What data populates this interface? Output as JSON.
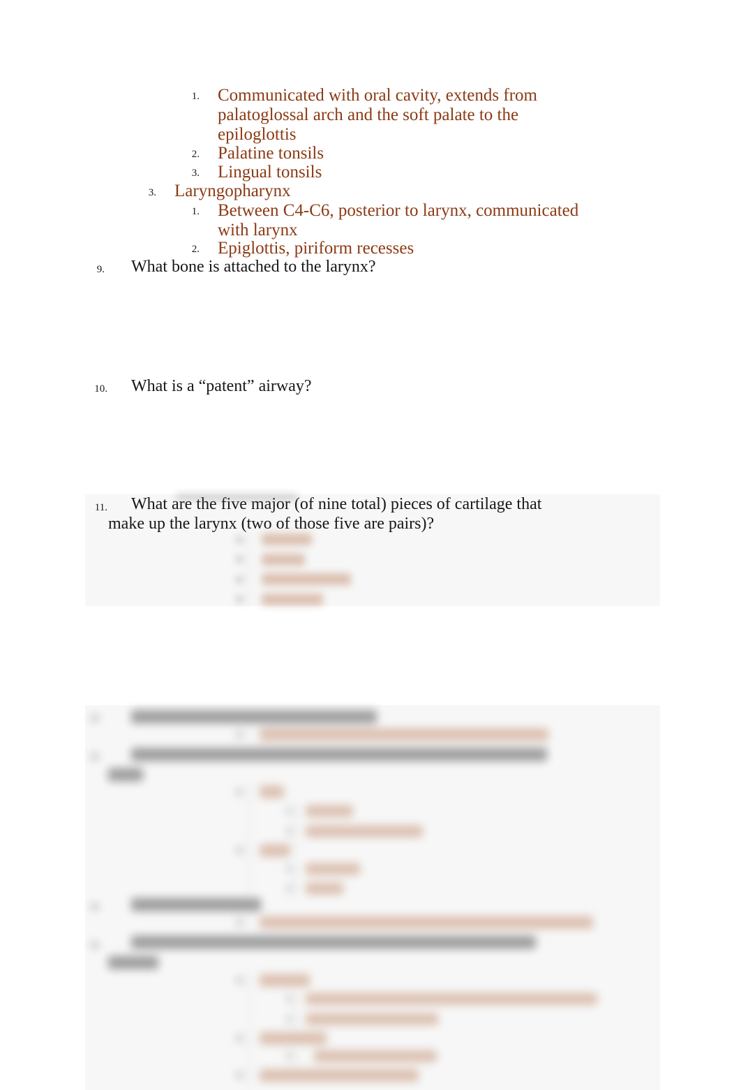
{
  "document": {
    "type": "study-guide-worksheet",
    "page_background": "#ffffff",
    "accent_color": "#8b3a14",
    "body_color": "#171717",
    "panel_color": "#f7f7f7"
  },
  "clear_content": {
    "nested_list": [
      {
        "marker": "1.",
        "text": "Communicated with oral cavity, extends from palatoglossal arch and the soft palate to the epiglottis",
        "level": 3,
        "color": "#8b3a14"
      },
      {
        "marker": "2.",
        "text": "Palatine tonsils",
        "level": 3,
        "color": "#8b3a14"
      },
      {
        "marker": "3.",
        "text": "Lingual tonsils",
        "level": 3,
        "color": "#8b3a14"
      },
      {
        "marker": "3.",
        "text": "Laryngopharynx",
        "level": 2,
        "color": "#8b3a14"
      },
      {
        "marker": "1.",
        "text": "Between C4-C6, posterior to larynx, communicated with larynx",
        "level": 3,
        "color": "#8b3a14"
      },
      {
        "marker": "2.",
        "text": "Epiglottis, piriform recesses",
        "level": 3,
        "color": "#8b3a14"
      }
    ],
    "line_fragments": {
      "l1a": "Communicated with oral cavity, extends from",
      "l1b": "palatoglossal arch and the soft palate to the",
      "l1c": "epiloglottis",
      "l2": "Palatine tonsils",
      "l3": "Lingual tonsils",
      "l4": "Laryngopharynx",
      "l5a": "Between C4-C6, posterior to larynx, communicated",
      "l5b": "with larynx",
      "l6": "Epiglottis, piriform recesses"
    },
    "questions": [
      {
        "marker": "9.",
        "text": "What bone is attached to the larynx?"
      },
      {
        "marker": "10.",
        "text": "What is a “patent” airway?"
      },
      {
        "marker": "11.",
        "line1": "What are the five major (of nine total) pieces of cartilage that",
        "line2": "make up the larynx (two of those five are pairs)?"
      }
    ]
  },
  "markers": {
    "m1": "1.",
    "m2": "2.",
    "m3": "3.",
    "m_lar": "3.",
    "m5": "1.",
    "m6": "2.",
    "q9": "9.",
    "q10": "10.",
    "q11": "11."
  },
  "blurred_regions": [
    {
      "id": "answers-q11",
      "description": "Four blurred brown answer sub-items beneath question 11",
      "legible": false,
      "line_count": 4
    },
    {
      "id": "questions-12-15",
      "description": "Blurred lower block containing questions 12 through 15 with brown nested answers",
      "legible": false,
      "line_count": 18
    }
  ]
}
